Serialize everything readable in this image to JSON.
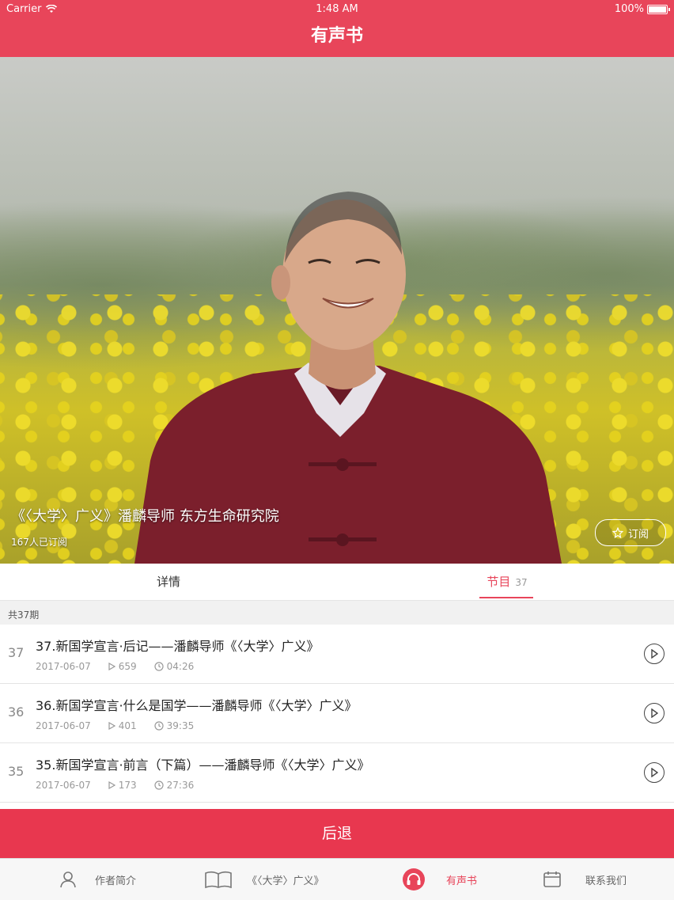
{
  "status_bar": {
    "carrier": "Carrier",
    "time": "1:48 AM",
    "battery": "100%"
  },
  "nav": {
    "title": "有声书"
  },
  "hero": {
    "title": "《〈大学〉广义》潘麟导师 东方生命研究院",
    "subscribers": "167人已订阅",
    "subscribe_label": "订阅"
  },
  "tabs": {
    "details": "详情",
    "episodes": "节目",
    "episodes_count": "37"
  },
  "episode_total": "共37期",
  "episodes": [
    {
      "num": "37",
      "title": "37.新国学宣言·后记——潘麟导师《〈大学〉广义》",
      "date": "2017-06-07",
      "plays": "659",
      "duration": "04:26"
    },
    {
      "num": "36",
      "title": "36.新国学宣言·什么是国学——潘麟导师《〈大学〉广义》",
      "date": "2017-06-07",
      "plays": "401",
      "duration": "39:35"
    },
    {
      "num": "35",
      "title": "35.新国学宣言·前言（下篇）——潘麟导师《〈大学〉广义》",
      "date": "2017-06-07",
      "plays": "173",
      "duration": "27:36"
    }
  ],
  "back_button": "后退",
  "tab_bar": {
    "author": "作者简介",
    "book": "《〈大学〉广义》",
    "audio": "有声书",
    "contact": "联系我们"
  },
  "colors": {
    "accent": "#e8455a",
    "back_button": "#e8374f"
  }
}
